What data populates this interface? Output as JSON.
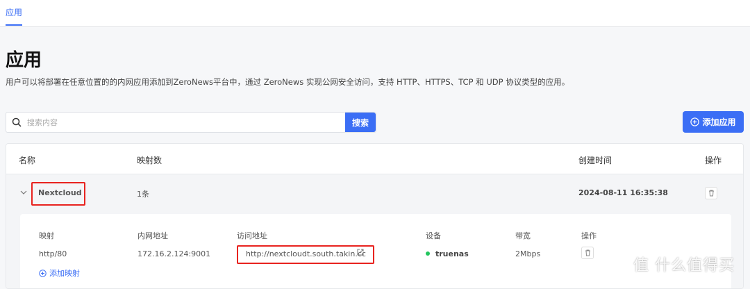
{
  "tab": {
    "label": "应用"
  },
  "page": {
    "title": "应用",
    "description": "用户可以将部署在任意位置的的内网应用添加到ZeroNews平台中，通过 ZeroNews 实现公网安全访问，支持 HTTP、HTTPS、TCP 和 UDP 协议类型的应用。"
  },
  "search": {
    "placeholder": "搜索内容",
    "button": "搜索"
  },
  "add_app_button": "添加应用",
  "table": {
    "columns": [
      "名称",
      "映射数",
      "创建时间",
      "操作"
    ],
    "rows": [
      {
        "name": "Nextcloud",
        "mappings": "1条",
        "created": "2024-08-11 16:35:38",
        "sub": {
          "columns": [
            "映射",
            "内网地址",
            "访问地址",
            "设备",
            "带宽",
            "操作"
          ],
          "rows": [
            {
              "mapping": "http/80",
              "internal": "172.16.2.124:9001",
              "url": "http://nextcloudt.south.takin.cc",
              "device": "truenas",
              "device_status_color": "#22c55e",
              "bandwidth": "2Mbps"
            }
          ],
          "add_mapping": "添加映射"
        }
      }
    ]
  },
  "colors": {
    "accent": "#3b6ef5",
    "annotation": "#e8231f"
  },
  "watermark": "值 什么值得买"
}
